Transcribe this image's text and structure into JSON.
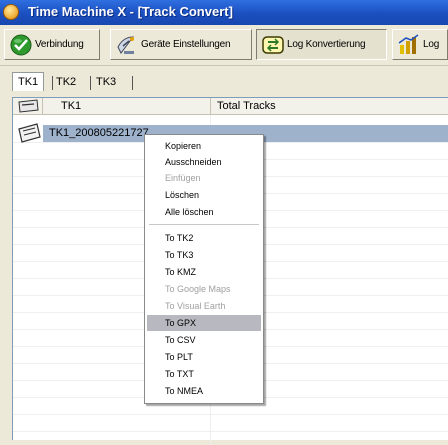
{
  "window": {
    "title": "Time Machine X - [Track Convert]"
  },
  "toolbar": {
    "buttons": [
      {
        "label": "Verbindung",
        "icon": "connection-icon"
      },
      {
        "label": "Geräte Einstellungen",
        "icon": "satellite-dish-icon"
      },
      {
        "label": "Log Konvertierung",
        "icon": "convert-icon"
      },
      {
        "label": "Log",
        "icon": "log-chart-icon"
      }
    ]
  },
  "tabs": [
    {
      "label": "TK1",
      "selected": true
    },
    {
      "label": "TK2",
      "selected": false
    },
    {
      "label": "TK3",
      "selected": false
    }
  ],
  "list": {
    "columns": [
      "TK1",
      "Total Tracks"
    ],
    "rows": [
      {
        "name": "TK1_200805221727",
        "total": "",
        "selected": true
      }
    ]
  },
  "context_menu": {
    "group1": [
      {
        "label": "Kopieren",
        "enabled": true
      },
      {
        "label": "Ausschneiden",
        "enabled": true
      },
      {
        "label": "Einfügen",
        "enabled": false
      },
      {
        "label": "Löschen",
        "enabled": true
      },
      {
        "label": "Alle löschen",
        "enabled": true
      }
    ],
    "group2": [
      {
        "label": "To TK2",
        "enabled": true
      },
      {
        "label": "To TK3",
        "enabled": true
      },
      {
        "label": "To KMZ",
        "enabled": true
      },
      {
        "label": "To Google Maps",
        "enabled": false
      },
      {
        "label": "To Visual Earth",
        "enabled": false
      },
      {
        "label": "To GPX",
        "enabled": true,
        "highlighted": true
      },
      {
        "label": "To CSV",
        "enabled": true
      },
      {
        "label": "To PLT",
        "enabled": true
      },
      {
        "label": "To TXT",
        "enabled": true
      },
      {
        "label": "To NMEA",
        "enabled": true
      }
    ]
  },
  "colors": {
    "titlebar": "#1b4fc0",
    "selection": "#9fb2cc",
    "menu_highlight": "#b8b8c0"
  }
}
